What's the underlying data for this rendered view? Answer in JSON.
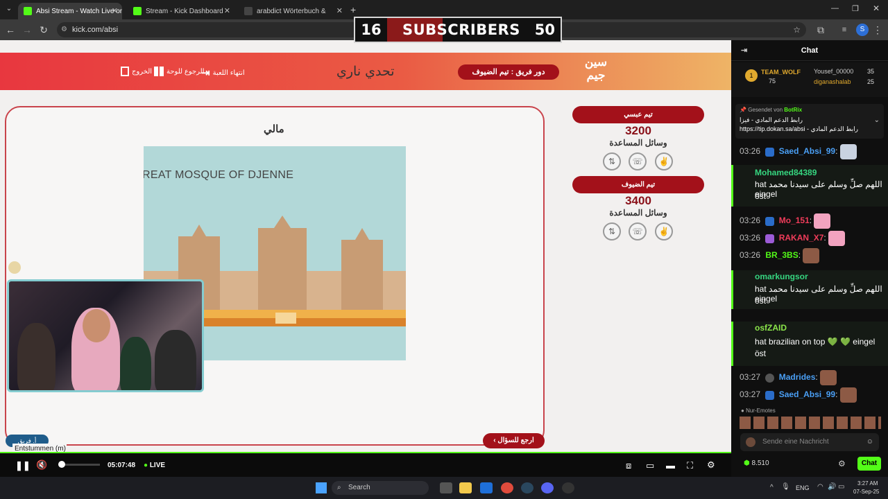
{
  "browser": {
    "tabs": [
      {
        "label": "Absi Stream - Watch Live on Kick",
        "active": true
      },
      {
        "label": "Stream - Kick Dashboard",
        "active": false
      },
      {
        "label": "arabdict Wörterbuch & Übersetzer",
        "active": false
      }
    ],
    "url": "kick.com/absi",
    "profile_initial": "S"
  },
  "overlay": {
    "sub_current": "16",
    "sub_label": "SUBSCRIBERS",
    "sub_goal": "50",
    "progress_fraction": 0.32
  },
  "game": {
    "exit_label": "الخروج",
    "board_label": "الرجوع للوحة",
    "end_label": "انتهاء اللعبة",
    "title": "تحدي ناري",
    "turn_prefix": "دور فريق :",
    "turn_team": "تيم الضيوف",
    "logo_line1": "سين",
    "logo_line2": "جيم",
    "category": "مالي",
    "image_caption": "REAT MOSQUE OF DJENNE",
    "teams": [
      {
        "name": "تيم عبسي",
        "score": "3200",
        "aids_label": "وسائل المساعدة"
      },
      {
        "name": "تيم الضيوف",
        "score": "3400",
        "aids_label": "وسائل المساعدة"
      }
    ],
    "back_label": "ارجع للسؤال",
    "team_badge": "أ. فريق"
  },
  "player": {
    "tooltip": "Entstummen (m)",
    "time": "05:07:48",
    "live": "LIVE"
  },
  "chat": {
    "title": "Chat",
    "top_gifter": {
      "name": "TEAM_WOLF",
      "count": "75"
    },
    "gifters": [
      {
        "name": "Yousef_00000",
        "count": "35"
      },
      {
        "name": "diganashalab",
        "count": "25"
      }
    ],
    "pinned": {
      "sender_prefix": "Gesendet von",
      "sender": "BotRix",
      "line1": "رابط الدعم المادي - فيزا",
      "line2": "https://tip.dokan.sa/absi - رابط الدعم المادي"
    },
    "messages": [
      {
        "time": "03:26",
        "user": "Saed_Absi_99",
        "text": ":"
      },
      {
        "user": "Mohamed84389",
        "line1": "hat اللهم صلِّ وسلم على سيدنا محمد eingel",
        "line2": "öst"
      },
      {
        "time": "03:26",
        "user": "Mo_151",
        "text": ":"
      },
      {
        "time": "03:26",
        "user": "RAKAN_X7",
        "text": ":"
      },
      {
        "time": "03:26",
        "user": "BR_3BS",
        "text": ":"
      },
      {
        "user": "omarkungsor",
        "line1": "hat اللهم صلِّ وسلم على سيدنا محمد eingel",
        "line2": "öst"
      },
      {
        "user": "osfZAID",
        "line1": "hat brazilian on top 💚 💚 eingel",
        "line2": "öst"
      },
      {
        "time": "03:27",
        "user": "Madrides",
        "text": ":"
      },
      {
        "time": "03:27",
        "user": "Saed_Absi_99",
        "text": ":"
      }
    ],
    "emote_label": "Nur-Emotes",
    "input_placeholder": "Sende eine Nachricht",
    "viewer_count": "8.510",
    "send_label": "Chat"
  },
  "taskbar": {
    "search": "Search",
    "lang": "ENG",
    "time": "3:27 AM",
    "date": "07-Sep-25"
  },
  "colors": {
    "kick_green": "#53fc18",
    "game_red": "#a3111a",
    "chat_bg": "#0f0f0f"
  }
}
